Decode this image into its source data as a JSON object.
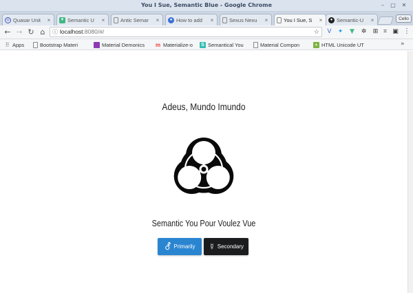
{
  "window": {
    "title": "You I Sue, Semantic Blue - Google Chrome"
  },
  "tabs": [
    {
      "label": "Quasar Unit",
      "icon": "quasar-icon",
      "color": "#3f51b5"
    },
    {
      "label": "Semantic U",
      "icon": "vue-icon",
      "color": "#41b883"
    },
    {
      "label": "Antic Semar",
      "icon": "page-icon",
      "color": "#777777"
    },
    {
      "label": "How to add",
      "icon": "globe-icon",
      "color": "#3b6fd6"
    },
    {
      "label": "Sexus Nexu",
      "icon": "page-icon",
      "color": "#777777"
    },
    {
      "label": "You I Sue, S",
      "icon": "page-icon",
      "color": "#777777",
      "active": true
    },
    {
      "label": "Semantic-U",
      "icon": "github-icon",
      "color": "#222222"
    }
  ],
  "profile_label": "Cello",
  "address": {
    "host": "localhost",
    "path": ":8080/#/"
  },
  "bookmarks": [
    {
      "label": "Apps",
      "icon": "apps-grid-icon"
    },
    {
      "label": "Bootstrap Materi",
      "icon": "page-icon"
    },
    {
      "label": "Material Demonics",
      "icon": "purple-square-icon"
    },
    {
      "label": "Materialize-o",
      "icon": "materialize-m-icon"
    },
    {
      "label": "Semantical You",
      "icon": "semantic-s-icon"
    },
    {
      "label": "Material Compon",
      "icon": "page-icon"
    },
    {
      "label": "HTML Unicode UT",
      "icon": "image-icon"
    }
  ],
  "main": {
    "heading": "Adeus, Mundo Imundo",
    "subheading": "Semantic You Pour Voulez Vue",
    "primary_button": {
      "label": "Primarily",
      "symbol": "⚦"
    },
    "secondary_button": {
      "label": "Secondary",
      "symbol": "☿"
    }
  },
  "colors": {
    "primary": "#2a85d1",
    "secondary": "#1b1c1d"
  }
}
